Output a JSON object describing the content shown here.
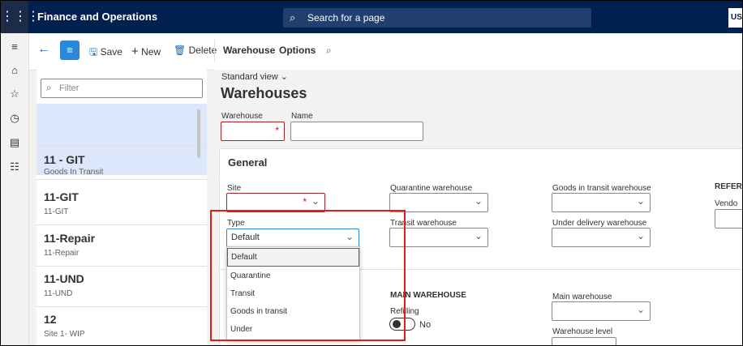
{
  "topbar": {
    "waffle": "⋮⋮⋮",
    "app_name": "Finance and Operations",
    "search_placeholder": "Search for a page",
    "user_initials": "US"
  },
  "leftnav": {
    "icons": [
      "hamburger-icon",
      "home-icon",
      "star-icon",
      "clock-icon",
      "workspace-icon",
      "modules-icon"
    ]
  },
  "actionbar": {
    "save": "Save",
    "new": "New",
    "delete": "Delete",
    "warehouse": "Warehouse",
    "options": "Options"
  },
  "listpane": {
    "filter_placeholder": "Filter",
    "items": [
      {
        "title": "11 - GIT",
        "subtitle": "Goods In Transit"
      },
      {
        "title": "11-GIT",
        "subtitle": "11-GIT"
      },
      {
        "title": "11-Repair",
        "subtitle": "11-Repair"
      },
      {
        "title": "11-UND",
        "subtitle": "11-UND"
      },
      {
        "title": "12",
        "subtitle": "Site 1- WIP"
      }
    ]
  },
  "main": {
    "view": "Standard view",
    "title": "Warehouses",
    "warehouse_label": "Warehouse",
    "name_label": "Name",
    "general": "General",
    "site_label": "Site",
    "quarantine_label": "Quarantine warehouse",
    "git_label": "Goods in transit warehouse",
    "refer_label": "REFER",
    "vendor_label": "Vendo",
    "type_label": "Type",
    "type_value": "Default",
    "transit_label": "Transit warehouse",
    "under_delivery_label": "Under delivery warehouse",
    "type_options": [
      "Default",
      "Quarantine",
      "Transit",
      "Goods in transit",
      "Under"
    ],
    "main_warehouse_heading": "MAIN WAREHOUSE",
    "refilling_label": "Refilling",
    "refilling_value": "No",
    "main_warehouse_label": "Main warehouse",
    "warehouse_level_label": "Warehouse level"
  },
  "colors": {
    "topbar": "#002050",
    "accent": "#2b88d8",
    "required": "#a4262c",
    "highlight_box": "#e51c1c",
    "selected_row": "#dce7fb"
  }
}
